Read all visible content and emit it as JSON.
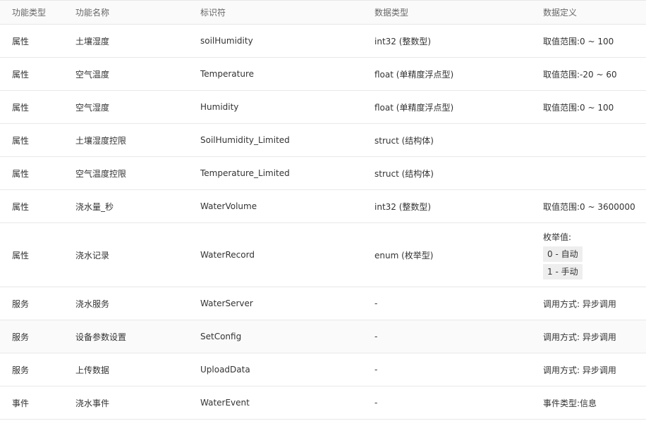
{
  "table": {
    "headers": [
      "功能类型",
      "功能名称",
      "标识符",
      "数据类型",
      "数据定义"
    ],
    "rows": [
      {
        "type": "属性",
        "name": "土壤湿度",
        "identifier": "soilHumidity",
        "data_type": "int32 (整数型)",
        "definition": "取值范围:0 ~ 100"
      },
      {
        "type": "属性",
        "name": "空气温度",
        "identifier": "Temperature",
        "data_type": "float (单精度浮点型)",
        "definition": "取值范围:-20 ~ 60"
      },
      {
        "type": "属性",
        "name": "空气湿度",
        "identifier": "Humidity",
        "data_type": "float (单精度浮点型)",
        "definition": "取值范围:0 ~ 100"
      },
      {
        "type": "属性",
        "name": "土壤湿度控限",
        "identifier": "SoilHumidity_Limited",
        "data_type": "struct (结构体)",
        "definition": ""
      },
      {
        "type": "属性",
        "name": "空气温度控限",
        "identifier": "Temperature_Limited",
        "data_type": "struct (结构体)",
        "definition": ""
      },
      {
        "type": "属性",
        "name": "浇水量_秒",
        "identifier": "WaterVolume",
        "data_type": "int32 (整数型)",
        "definition": "取值范围:0 ~ 3600000"
      },
      {
        "type": "属性",
        "name": "浇水记录",
        "identifier": "WaterRecord",
        "data_type": "enum (枚举型)",
        "definition": "",
        "enum_label": "枚举值:",
        "enum_values": [
          "0 - 自动",
          "1 - 手动"
        ]
      },
      {
        "type": "服务",
        "name": "浇水服务",
        "identifier": "WaterServer",
        "data_type": "-",
        "definition": "调用方式: 异步调用"
      },
      {
        "type": "服务",
        "name": "设备参数设置",
        "identifier": "SetConfig",
        "data_type": "-",
        "definition": "调用方式: 异步调用"
      },
      {
        "type": "服务",
        "name": "上传数据",
        "identifier": "UploadData",
        "data_type": "-",
        "definition": "调用方式: 异步调用"
      },
      {
        "type": "事件",
        "name": "浇水事件",
        "identifier": "WaterEvent",
        "data_type": "-",
        "definition": "事件类型:信息"
      }
    ]
  }
}
